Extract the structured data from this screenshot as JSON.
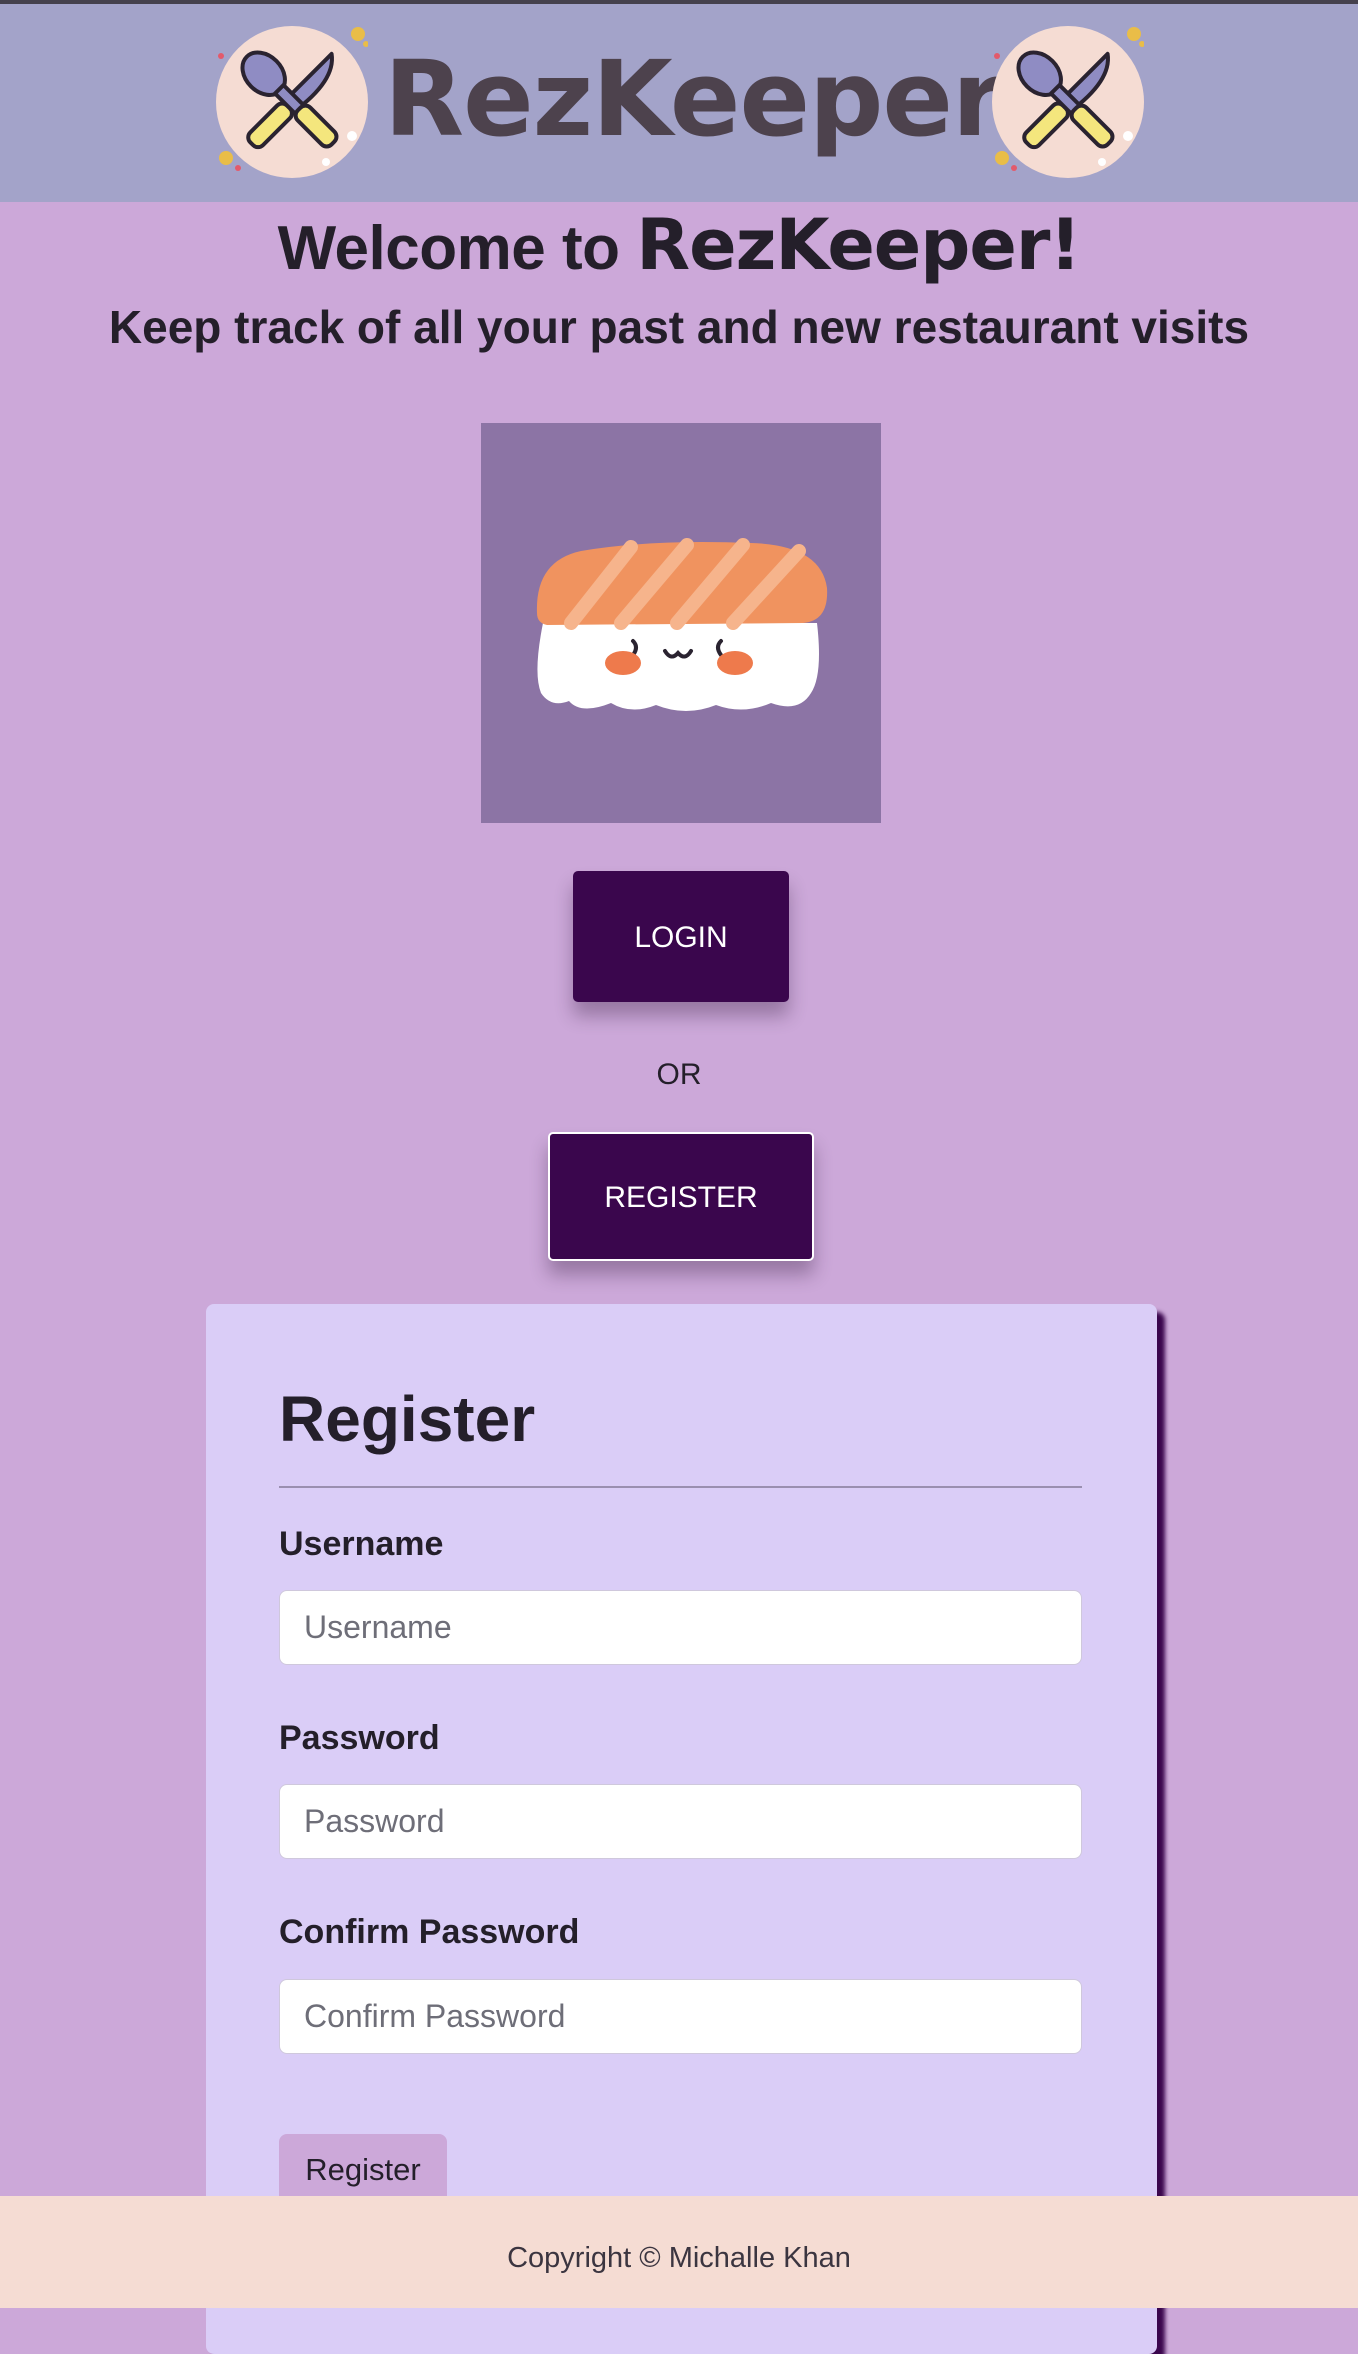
{
  "header": {
    "brand": "RezKeeper"
  },
  "welcome": {
    "prefix": "Welcome to ",
    "brand": "RezKeeper!",
    "tagline": "Keep track of all your past and new restaurant visits"
  },
  "actions": {
    "login_label": "LOGIN",
    "or_label": "OR",
    "register_label": "REGISTER"
  },
  "register_form": {
    "title": "Register",
    "username": {
      "label": "Username",
      "placeholder": "Username",
      "value": ""
    },
    "password": {
      "label": "Password",
      "placeholder": "Password",
      "value": ""
    },
    "confirm_password": {
      "label": "Confirm Password",
      "placeholder": "Confirm Password",
      "value": ""
    },
    "submit_label": "Register"
  },
  "footer": {
    "copyright": "Copyright © Michalle Khan"
  },
  "icons": {
    "logo": "crossed-knife-spoon-icon",
    "hero": "sushi-illustration"
  },
  "colors": {
    "header_bg": "#a3a3c9",
    "page_bg": "#cca8d9",
    "button_bg": "#3a064d",
    "card_bg": "#dacdf7",
    "footer_bg": "#f5dcd3"
  }
}
